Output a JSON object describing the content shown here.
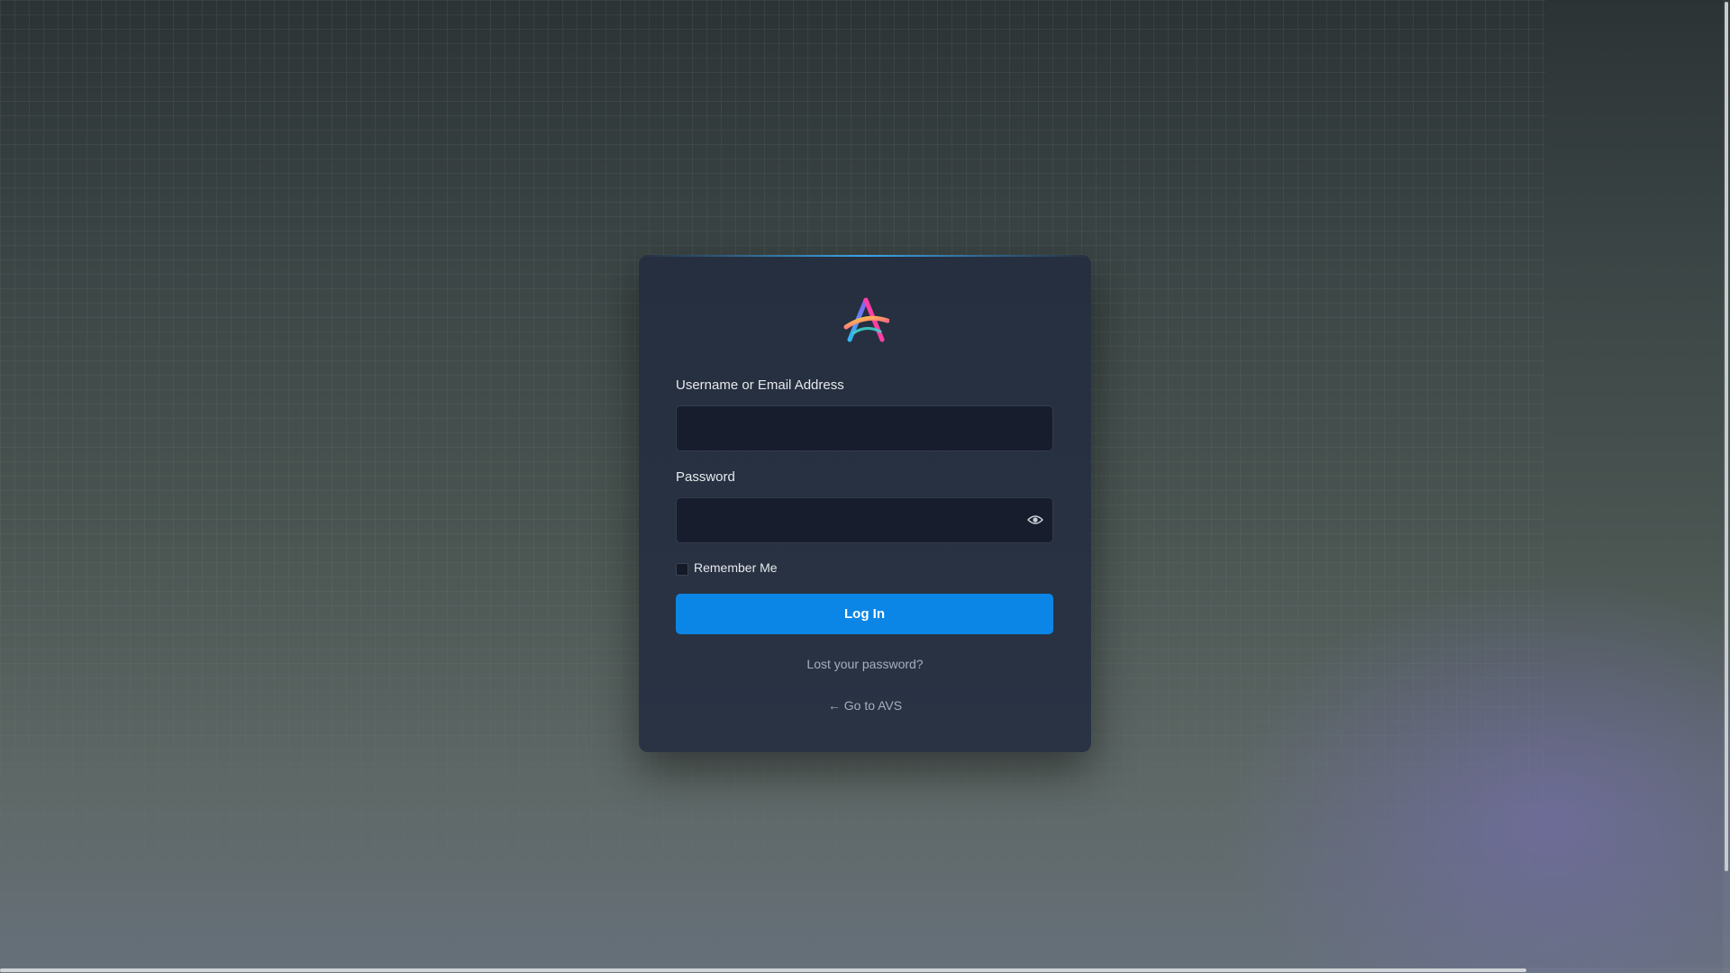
{
  "login_form": {
    "username_label": "Username or Email Address",
    "username_value": "",
    "password_label": "Password",
    "password_value": "",
    "show_password_icon": "eye-icon",
    "remember_label": "Remember Me",
    "remember_checked": false,
    "submit_label": "Log In",
    "lost_password_label": "Lost your password?",
    "back_arrow": "←",
    "back_label": "Go to AVS"
  },
  "colors": {
    "accent": "#0b86e6",
    "card_background": "#262f3f",
    "input_background": "#171d2c",
    "link_text": "#a7afbd"
  },
  "logo": {
    "icon": "colorful-a-logo-icon"
  }
}
